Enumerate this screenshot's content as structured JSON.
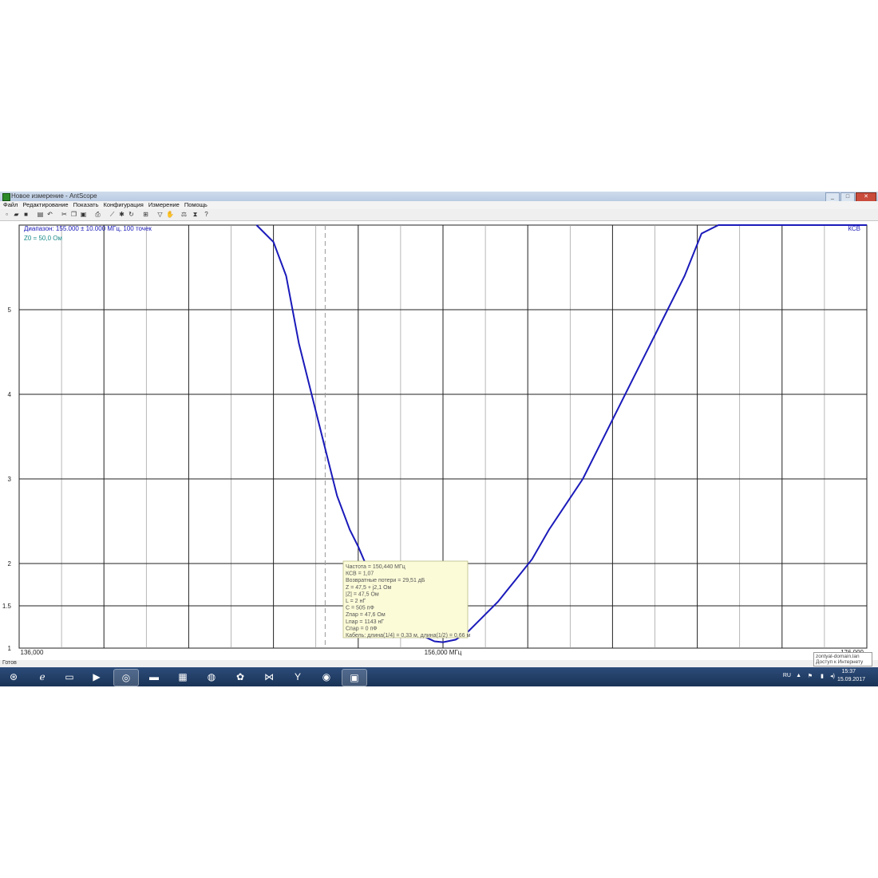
{
  "window": {
    "title": "Новое измерение - AntScope",
    "min": "_",
    "max": "□",
    "close": "✕"
  },
  "menu": [
    "Файл",
    "Редактирование",
    "Показать",
    "Конфигурация",
    "Измерение",
    "Помощь"
  ],
  "toolbar_icons": [
    "new-file-icon",
    "open-icon",
    "save-icon",
    "settings-icon",
    "undo-icon",
    "cut-icon",
    "copy-icon",
    "paste-icon",
    "print-icon",
    "chart-icon",
    "star-icon",
    "refresh-icon",
    "zoom-icon",
    "marker-icon",
    "hand-icon",
    "level-icon",
    "hourglass-icon",
    "help-icon"
  ],
  "plot": {
    "range_label": "Диапазон: 155.000 ± 10.000 МГц, 100 точек",
    "z0_label": "Z0 = 50,0 Ом",
    "series_label": "КСВ"
  },
  "tooltip": {
    "lines": [
      "Частота = 150,440 МГц",
      "КСВ = 1,07",
      "Возвратные потери = 29,51 дБ",
      "Z = 47,5 + j2,1 Ом",
      "|Z| = 47,5 Ом",
      "L = 2 нГ",
      "C = 505 пФ",
      "Zпар = 47,6 Ом",
      "Lпар = 1143 нГ",
      "Cпар = 0 пФ",
      "Кабель: длина(1/4) = 0,33 м, длина(1/2) = 0,66 м"
    ]
  },
  "status": {
    "text": "Готов"
  },
  "notification": {
    "line1": "zontyal-domain.lan",
    "line2": "Доступ к Интернету"
  },
  "tray": {
    "lang": "RU",
    "time": "15:37",
    "date": "15.09.2017"
  },
  "chart_data": {
    "type": "line",
    "title": "",
    "xlabel": "156,000 МГц",
    "ylabel": "",
    "xlim": [
      136,
      176
    ],
    "ylim": [
      1,
      6
    ],
    "x_tick_labels": {
      "min": "136,000",
      "center": "156,000 МГц",
      "max": "176,000"
    },
    "y_ticks": [
      1,
      1.5,
      2,
      3,
      4,
      5
    ],
    "series": [
      {
        "name": "КСВ",
        "color": "#1a1aba",
        "x": [
          147.2,
          148.0,
          148.6,
          149.2,
          149.8,
          150.4,
          151.0,
          151.6,
          152.0,
          152.6,
          153.2,
          153.8,
          154.4,
          155.0,
          155.6,
          156.0,
          156.6,
          157.2,
          157.8,
          158.6,
          159.4,
          160.2,
          161.0,
          161.8,
          162.6,
          163.4,
          164.2,
          165.0,
          165.8,
          166.6,
          167.4,
          168.2,
          169.0,
          169.6,
          170.4,
          171.2,
          172.0
        ],
        "y": [
          6.0,
          5.8,
          5.4,
          4.6,
          4.0,
          3.4,
          2.8,
          2.4,
          2.2,
          1.85,
          1.62,
          1.43,
          1.28,
          1.15,
          1.08,
          1.07,
          1.1,
          1.2,
          1.35,
          1.55,
          1.8,
          2.05,
          2.4,
          2.7,
          3.0,
          3.4,
          3.8,
          4.2,
          4.6,
          5.0,
          5.4,
          5.9,
          6.0,
          6.0,
          6.0,
          6.0,
          6.0
        ]
      }
    ],
    "marker_x": 150.44,
    "grid": true,
    "legend": "top-right"
  },
  "colors": {
    "grid": "#222222",
    "line": "#1a1aba",
    "tooltip_bg": "#fbfbd8",
    "marker": "#999999"
  }
}
